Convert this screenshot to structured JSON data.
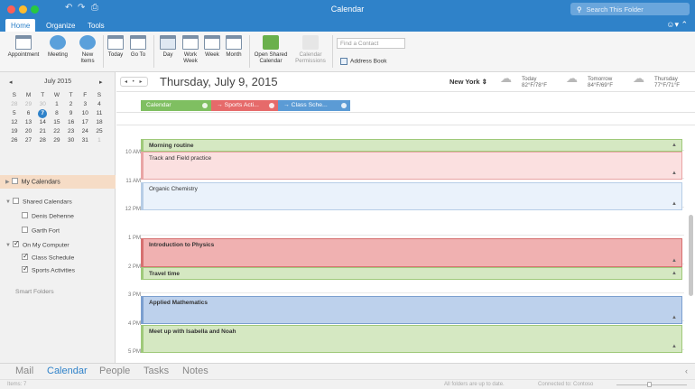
{
  "window": {
    "title": "Calendar",
    "search_placeholder": "Search This Folder"
  },
  "ribbon_tabs": [
    {
      "label": "Home",
      "active": true
    },
    {
      "label": "Organize"
    },
    {
      "label": "Tools"
    }
  ],
  "ribbon": {
    "appointment": "Appointment",
    "meeting": "Meeting",
    "new_items": [
      "New",
      "Items"
    ],
    "today": "Today",
    "go_to": "Go To",
    "day": "Day",
    "work_week": [
      "Work",
      "Week"
    ],
    "week": "Week",
    "month": "Month",
    "open_shared": [
      "Open Shared",
      "Calendar"
    ],
    "permissions": [
      "Calendar",
      "Permissions"
    ],
    "find_contact_placeholder": "Find a Contact",
    "address_book": "Address Book"
  },
  "mini_calendar": {
    "month": "July 2015",
    "prev": "◂",
    "next": "▸",
    "weekdays": [
      "S",
      "M",
      "T",
      "W",
      "T",
      "F",
      "S"
    ],
    "weeks": [
      [
        {
          "d": "28",
          "dim": true
        },
        {
          "d": "29",
          "dim": true
        },
        {
          "d": "30",
          "dim": true
        },
        {
          "d": "1"
        },
        {
          "d": "2"
        },
        {
          "d": "3"
        },
        {
          "d": "4"
        }
      ],
      [
        {
          "d": "5"
        },
        {
          "d": "6"
        },
        {
          "d": "7",
          "today": true
        },
        {
          "d": "8"
        },
        {
          "d": "9"
        },
        {
          "d": "10"
        },
        {
          "d": "11"
        }
      ],
      [
        {
          "d": "12"
        },
        {
          "d": "13"
        },
        {
          "d": "14"
        },
        {
          "d": "15"
        },
        {
          "d": "16"
        },
        {
          "d": "17"
        },
        {
          "d": "18"
        }
      ],
      [
        {
          "d": "19"
        },
        {
          "d": "20"
        },
        {
          "d": "21"
        },
        {
          "d": "22"
        },
        {
          "d": "23"
        },
        {
          "d": "24"
        },
        {
          "d": "25"
        }
      ],
      [
        {
          "d": "26"
        },
        {
          "d": "27"
        },
        {
          "d": "28"
        },
        {
          "d": "29"
        },
        {
          "d": "30"
        },
        {
          "d": "31"
        },
        {
          "d": "1",
          "dim": true
        }
      ]
    ]
  },
  "sidebar": {
    "my_calendars": "My Calendars",
    "shared_calendars": "Shared Calendars",
    "shared_items": [
      "Denis Dehenne",
      "Garth Fort"
    ],
    "on_my_computer": "On My Computer",
    "local_items": [
      "Class Schedule",
      "Sports Activities"
    ],
    "smart_folders": "Smart Folders"
  },
  "header": {
    "nav": "◂ • ▸",
    "date_title": "Thursday, July 9, 2015",
    "location": "New York",
    "weather": [
      {
        "day": "Today",
        "temp": "82°F/78°F",
        "icon": "partly-cloudy-icon"
      },
      {
        "day": "Tomorrow",
        "temp": "84°F/69°F",
        "icon": "partly-cloudy-icon"
      },
      {
        "day": "Thursday",
        "temp": "77°F/71°F",
        "icon": "rain-cloud-icon"
      }
    ]
  },
  "calendar_tags": [
    {
      "label": "Calendar",
      "color": "#7fbf61"
    },
    {
      "label": "→ Sports Acti...",
      "color": "#e66a6a"
    },
    {
      "label": "→ Class Sche...",
      "color": "#5b9bd5"
    }
  ],
  "time_labels": [
    "10 AM",
    "11 AM",
    "12 PM",
    "1 PM",
    "2 PM",
    "3 PM",
    "4 PM",
    "5 PM"
  ],
  "events": [
    {
      "title": "Morning routine",
      "bg": "#d5e8c2",
      "border": "#9fc97a"
    },
    {
      "title": "Track and Field practice",
      "bg": "#fbe0e0",
      "border": "#e9a5a5"
    },
    {
      "title": "Organic Chemistry",
      "bg": "#eaf2fb",
      "border": "#b6cde6"
    },
    {
      "title": "Introduction to Physics",
      "bg": "#f0b1b1",
      "border": "#d67070"
    },
    {
      "title": "Travel time",
      "bg": "#d5e8c2",
      "border": "#9fc97a"
    },
    {
      "title": "Applied Mathematics",
      "bg": "#bdd1ec",
      "border": "#7b9fcf"
    },
    {
      "title": "Meet up with Isabella and Noah",
      "bg": "#d5e8c2",
      "border": "#9fc97a"
    }
  ],
  "bottom_nav": [
    "Mail",
    "Calendar",
    "People",
    "Tasks",
    "Notes"
  ],
  "status": {
    "items": "Items: 7",
    "sync": "All folders are up to date.",
    "connected": "Connected to: Contoso"
  }
}
